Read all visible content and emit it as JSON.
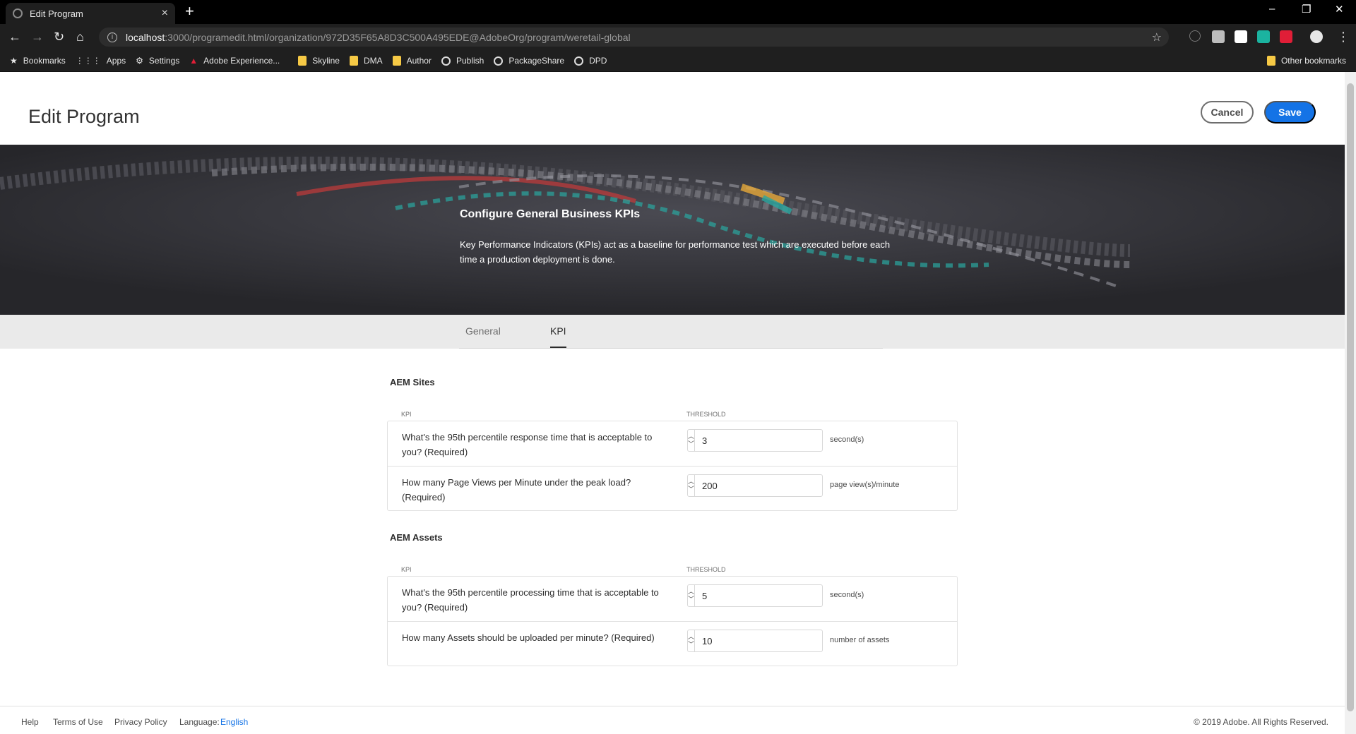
{
  "browser": {
    "tab_title": "Edit Program",
    "tab_close": "×",
    "new_tab": "+",
    "win_min": "–",
    "win_restore": "❐",
    "win_close": "✕",
    "url_host": "localhost",
    "url_path": ":3000/programedit.html/organization/972D35F65A8D3C500A495EDE@AdobeOrg/program/weretail-global",
    "bookmarks": [
      "Bookmarks",
      "Apps",
      "Settings",
      "Adobe Experience...",
      "Skyline",
      "DMA",
      "Author",
      "Publish",
      "PackageShare",
      "DPD"
    ],
    "other_bookmarks": "Other bookmarks"
  },
  "header": {
    "title": "Edit Program",
    "cancel_label": "Cancel",
    "save_label": "Save"
  },
  "hero": {
    "title": "Configure General Business KPIs",
    "text": "Key Performance Indicators (KPIs) act as a baseline for performance test which are executed before each time a production deployment is done."
  },
  "tabs": [
    "General",
    "KPI"
  ],
  "sections": [
    {
      "title": "AEM Sites",
      "col_kpi": "KPI",
      "col_threshold": "THRESHOLD",
      "rows": [
        {
          "question": "What's the 95th percentile response time that is acceptable to you? (Required)",
          "value": "3",
          "unit": "second(s)"
        },
        {
          "question": "How many Page Views per Minute under the peak load? (Required)",
          "value": "200",
          "unit": "page view(s)/minute"
        }
      ]
    },
    {
      "title": "AEM Assets",
      "col_kpi": "KPI",
      "col_threshold": "THRESHOLD",
      "rows": [
        {
          "question": "What's the 95th percentile processing time that is acceptable to you? (Required)",
          "value": "5",
          "unit": "second(s)"
        },
        {
          "question": "How many Assets should be uploaded per minute? (Required)",
          "value": "10",
          "unit": "number of assets"
        }
      ]
    }
  ],
  "footer": {
    "help": "Help",
    "terms": "Terms of Use",
    "privacy": "Privacy Policy",
    "language_label": "Language:",
    "language_value": "English",
    "copyright": "© 2019 Adobe. All Rights Reserved."
  },
  "colors": {
    "accent": "#1473e6",
    "hero_bg": "#2b2b2f",
    "browser_chrome": "#1f1f1f"
  }
}
